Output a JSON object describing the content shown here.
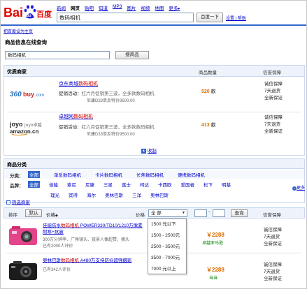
{
  "brand": {
    "logo_text": "百度",
    "logo_letters": "Bai"
  },
  "nav": {
    "items": [
      {
        "label": "新闻",
        "active": false
      },
      {
        "label": "网页",
        "active": true
      },
      {
        "label": "贴吧",
        "active": false
      },
      {
        "label": "知道",
        "active": false
      },
      {
        "label": "MP3",
        "active": false
      },
      {
        "label": "图片",
        "active": false
      },
      {
        "label": "视频",
        "active": false
      },
      {
        "label": "地图",
        "active": false
      },
      {
        "label": "更多▸",
        "active": false
      }
    ]
  },
  "search": {
    "query": "数码相机",
    "button_label": "百度一下",
    "help_links": "设置 | 帮助"
  },
  "homepage_link": "把百度设为主页",
  "product_search": {
    "title": "商品信息在线查询",
    "query": "数码相机",
    "button_label": "搜商品"
  },
  "merchants": {
    "header": {
      "title": "优质商家",
      "count_col": "商品数量",
      "guarantee_col": "信誉保障"
    },
    "rows": [
      {
        "name_prefix": "京东商城",
        "name_highlight": "数码相机",
        "promo_label": "促销活动：",
        "promo_line1": "红六月促销第三波，全多款数码相机",
        "promo_line2": "尼康D33单反特价9500.00",
        "count": "520",
        "unit": "款",
        "guarantees": [
          "诚信保障",
          "7天退货",
          "全新保证"
        ],
        "logo": "360buy.com"
      },
      {
        "name_prefix": "卓越网",
        "name_highlight": "数码相机",
        "promo_label": "促销活动：",
        "promo_line1": "红六月促销第三波，全多款数码相机",
        "promo_line2": "尼康D33单反特价9500.00",
        "count": "413",
        "unit": "款",
        "guarantees": [
          "诚信保障",
          "7天退货",
          "全新保证"
        ],
        "logo_joyo": "joyo卓越",
        "logo_amazon": "amazon.cn"
      }
    ],
    "collapse_label": "收起"
  },
  "categories": {
    "title": "商品分类",
    "class_label": "分类：",
    "classes": [
      {
        "label": "全部",
        "selected": true
      },
      {
        "label": "单反数码相机",
        "selected": false
      },
      {
        "label": "卡片数码相机",
        "selected": false
      },
      {
        "label": "长焦数码相机",
        "selected": false
      },
      {
        "label": "便携数码相机",
        "selected": false
      }
    ],
    "brand_label": "品牌：",
    "brands_row1": [
      {
        "label": "全部",
        "selected": true
      },
      {
        "label": "佳能",
        "selected": false
      },
      {
        "label": "索尼",
        "selected": false
      },
      {
        "label": "尼康",
        "selected": false
      },
      {
        "label": "三星",
        "selected": false
      },
      {
        "label": "富士",
        "selected": false
      },
      {
        "label": "柯达",
        "selected": false
      },
      {
        "label": "卡西欧",
        "selected": false
      },
      {
        "label": "爱国者",
        "selected": false
      },
      {
        "label": "松下",
        "selected": false
      },
      {
        "label": "明基",
        "selected": false
      }
    ],
    "brands_row2": [
      "理光",
      "宾得",
      "海尔",
      "奥林巴斯",
      "三洋",
      "奥林巴斯"
    ],
    "more_label": "更多",
    "filter_label": "筛选商家"
  },
  "sort_bar": {
    "sort_label": "排序",
    "default_label": "默认",
    "price_label": "价格",
    "price_filter_label": "价格",
    "price_select_value": "全 部",
    "query_button": "查询",
    "guarantee_col": "信誉保障"
  },
  "price_dropdown": {
    "options": [
      "1500 元以下",
      "1500 - 2500元",
      "2500 - 3500元",
      "3500 - 7000元",
      "7000 元以上"
    ]
  },
  "products": [
    {
      "title_prefix": "佳能防水",
      "title_highlight": "数码相机",
      "title_suffix": " POWER330/TD10/1210万像素",
      "title_line2": "耐寒+抗震",
      "desc": "300万分辨率、广角镜头、夜景人像超赞，摘头",
      "reviews": "已有2000人评价",
      "price": "￥2288",
      "merchant": "卓越亚马逊",
      "guarantees": [
        "诚信保障",
        "7天退货",
        "全新保证"
      ]
    },
    {
      "title_prefix": "奥林巴斯",
      "title_highlight": "数码相机",
      "title_suffix": " A480万支持防抖超强摄影",
      "reviews": "已有342人评价",
      "price": "￥2288",
      "merchant": "当当",
      "guarantees": [
        "诚信保障",
        "7天退货",
        "全新保证"
      ]
    }
  ],
  "colors": {
    "baidu_blue": "#2319dc",
    "baidu_red": "#e10602",
    "link": "#0000cc",
    "highlight": "#cc0000",
    "price_orange": "#e06d00",
    "box_border": "#c9d7f1",
    "box_head": "#eef3fb"
  }
}
